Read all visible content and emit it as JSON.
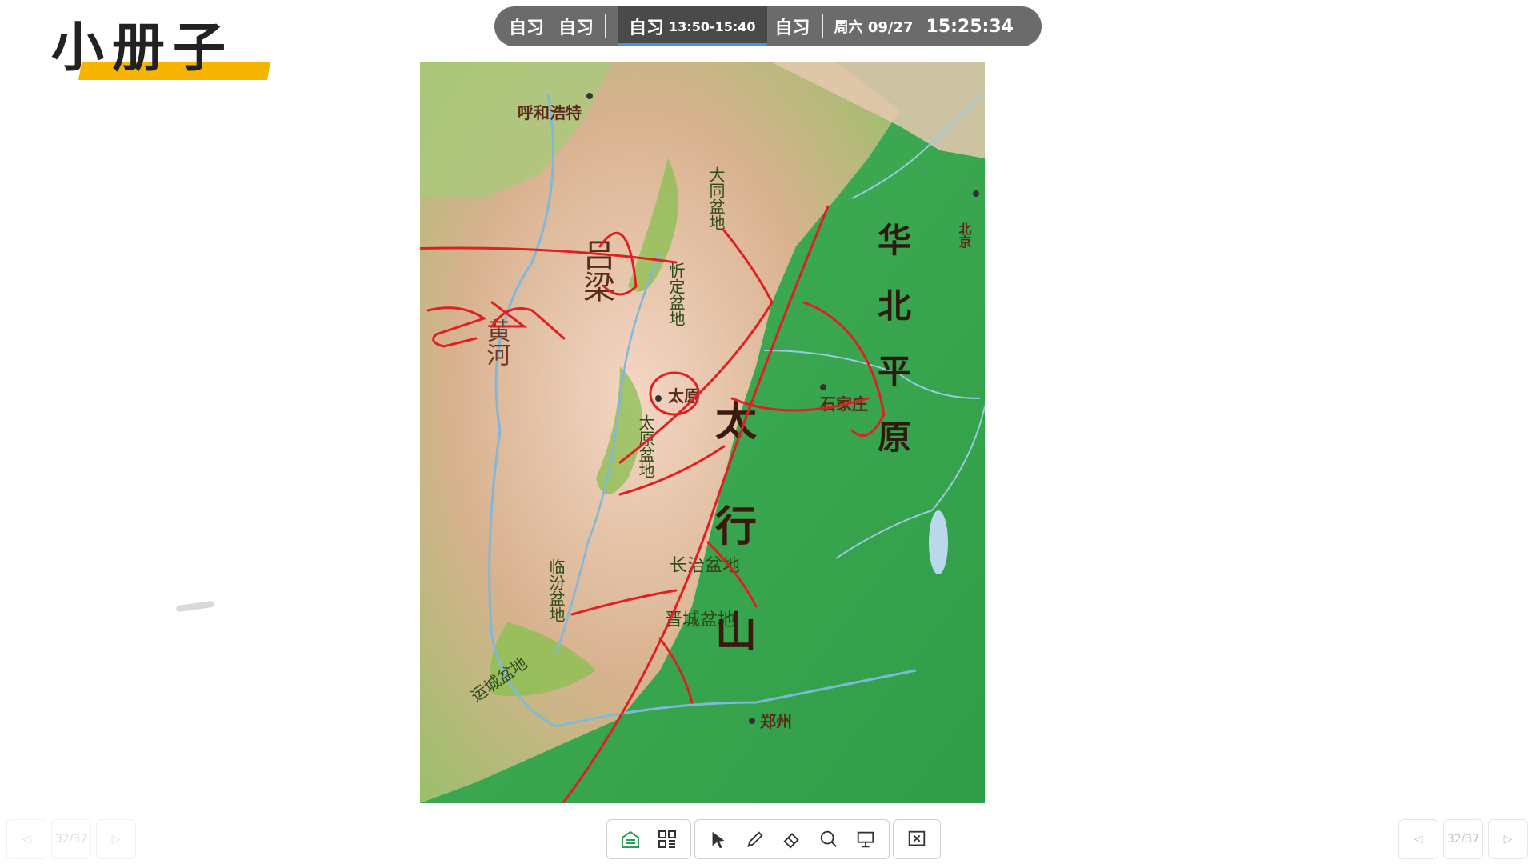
{
  "title": "小册子",
  "schedule": {
    "items": [
      "自习",
      "自习"
    ],
    "active_label": "自习",
    "active_time": "13:50-15:40",
    "next_label": "自习",
    "date": "周六 09/27",
    "clock": "15:25:34"
  },
  "map": {
    "place_labels": {
      "hohhot": "呼和浩特",
      "beijing": "北京",
      "taiyuan": "太原",
      "shijiazhuang": "石家庄",
      "zhengzhou": "郑州"
    },
    "region_labels": {
      "datong_basin": "大同盆地",
      "xinding_basin": "忻定盆地",
      "taiyuan_basin": "太原盆地",
      "changzhi_basin": "长治盆地",
      "jincheng_basin": "晋城盆地",
      "linfen_basin": "临汾盆地",
      "yuncheng_basin": "运城盆地",
      "lvliang": "吕梁",
      "taihang": "太行山",
      "huabei_plain": "华北平原",
      "yellow_river": "黄河"
    }
  },
  "toolbar": {
    "buttons": [
      "whiteboard-icon",
      "apps-icon",
      "pointer-icon",
      "pen-icon",
      "eraser-icon",
      "search-icon",
      "screen-icon",
      "exit-icon"
    ]
  },
  "pager": {
    "page": "32/37"
  },
  "colors": {
    "accent": "#f5b400",
    "annotation": "#e02020",
    "schedule_bg": "#6b6b6b",
    "active_underline": "#4d8ee6"
  }
}
